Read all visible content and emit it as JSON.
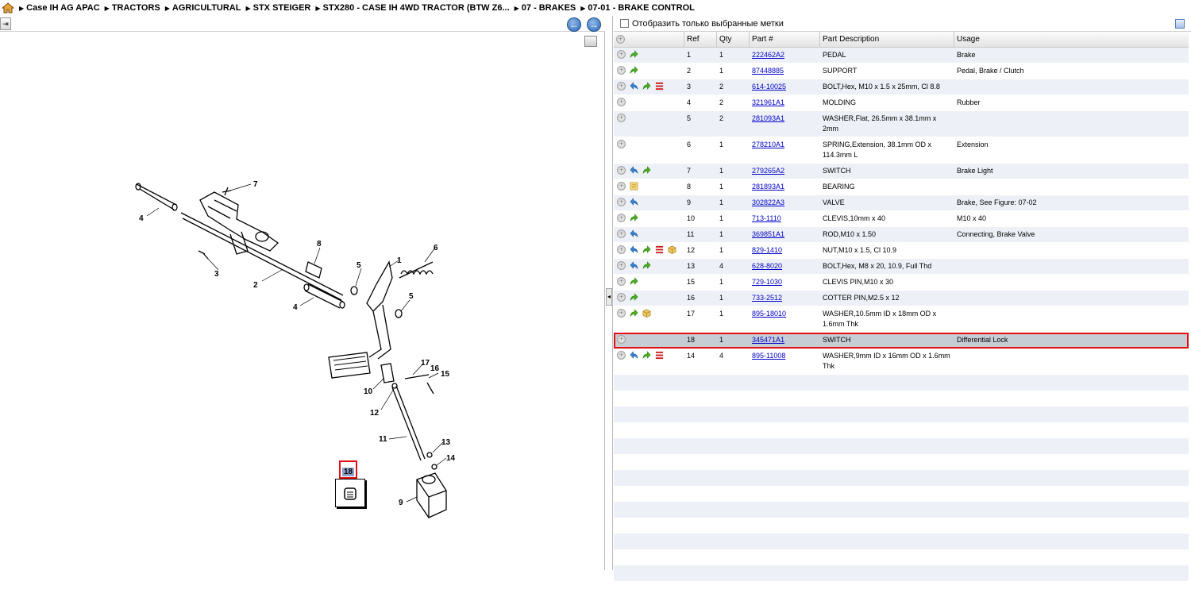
{
  "breadcrumb": [
    "Case IH AG APAC",
    "TRACTORS",
    "AGRICULTURAL",
    "STX STEIGER",
    "STX280 - CASE IH 4WD TRACTOR (BTW Z6...",
    "07 - BRAKES",
    "07-01 - BRAKE CONTROL"
  ],
  "filter": {
    "label": "Отобразить только выбранные метки"
  },
  "columns": {
    "ref": "Ref",
    "qty": "Qty",
    "part": "Part #",
    "desc": "Part Description",
    "usage": "Usage"
  },
  "parts": [
    {
      "icons": [
        "plus",
        "green"
      ],
      "ref": "1",
      "qty": "1",
      "part": "222462A2",
      "desc": "PEDAL",
      "usage": "Brake"
    },
    {
      "icons": [
        "plus",
        "green"
      ],
      "ref": "2",
      "qty": "1",
      "part": "87448885",
      "desc": "SUPPORT",
      "usage": "Pedal, Brake / Clutch"
    },
    {
      "icons": [
        "plus",
        "blue",
        "green",
        "red"
      ],
      "ref": "3",
      "qty": "2",
      "part": "614-10025",
      "desc": "BOLT,Hex, M10 x 1.5 x 25mm, Cl 8.8",
      "usage": ""
    },
    {
      "icons": [
        "plus"
      ],
      "ref": "4",
      "qty": "2",
      "part": "321961A1",
      "desc": "MOLDING",
      "usage": "Rubber"
    },
    {
      "icons": [
        "plus"
      ],
      "ref": "5",
      "qty": "2",
      "part": "281093A1",
      "desc": "WASHER,Flat, 26.5mm x 38.1mm x 2mm",
      "usage": ""
    },
    {
      "icons": [
        "plus"
      ],
      "ref": "6",
      "qty": "1",
      "part": "278210A1",
      "desc": "SPRING,Extension, 38.1mm OD x 114.3mm L",
      "usage": "Extension"
    },
    {
      "icons": [
        "plus",
        "blue",
        "green"
      ],
      "ref": "7",
      "qty": "1",
      "part": "279265A2",
      "desc": "SWITCH",
      "usage": "Brake Light"
    },
    {
      "icons": [
        "plus",
        "note"
      ],
      "ref": "8",
      "qty": "1",
      "part": "281893A1",
      "desc": "BEARING",
      "usage": ""
    },
    {
      "icons": [
        "plus",
        "blue"
      ],
      "ref": "9",
      "qty": "1",
      "part": "302822A3",
      "desc": "VALVE",
      "usage": "Brake, See Figure: 07-02"
    },
    {
      "icons": [
        "plus",
        "green"
      ],
      "ref": "10",
      "qty": "1",
      "part": "713-1110",
      "desc": "CLEVIS,10mm x 40",
      "usage": "M10 x 40"
    },
    {
      "icons": [
        "plus",
        "blue"
      ],
      "ref": "11",
      "qty": "1",
      "part": "369851A1",
      "desc": "ROD,M10 x 1.50",
      "usage": "Connecting, Brake Valve"
    },
    {
      "icons": [
        "plus",
        "blue",
        "green",
        "red",
        "box"
      ],
      "ref": "12",
      "qty": "1",
      "part": "829-1410",
      "desc": "NUT,M10 x 1.5, Cl 10.9",
      "usage": ""
    },
    {
      "icons": [
        "plus",
        "blue",
        "green"
      ],
      "ref": "13",
      "qty": "4",
      "part": "628-8020",
      "desc": "BOLT,Hex, M8 x 20, 10.9, Full Thd",
      "usage": ""
    },
    {
      "icons": [
        "plus",
        "green"
      ],
      "ref": "15",
      "qty": "1",
      "part": "729-1030",
      "desc": "CLEVIS PIN,M10 x 30",
      "usage": ""
    },
    {
      "icons": [
        "plus",
        "green"
      ],
      "ref": "16",
      "qty": "1",
      "part": "733-2512",
      "desc": "COTTER PIN,M2.5 x 12",
      "usage": ""
    },
    {
      "icons": [
        "plus",
        "green",
        "box"
      ],
      "ref": "17",
      "qty": "1",
      "part": "895-18010",
      "desc": "WASHER,10.5mm ID x 18mm OD x 1.6mm Thk",
      "usage": ""
    },
    {
      "icons": [
        "plus"
      ],
      "ref": "18",
      "qty": "1",
      "part": "345471A1",
      "desc": "SWITCH",
      "usage": "Differential Lock",
      "selected": true
    },
    {
      "icons": [
        "plus",
        "blue",
        "green",
        "red"
      ],
      "ref": "14",
      "qty": "4",
      "part": "895-11008",
      "desc": "WASHER,9mm ID x 16mm OD x 1.6mm Thk",
      "usage": ""
    }
  ],
  "diagram": {
    "callouts": [
      "1",
      "2",
      "3",
      "4",
      "4",
      "5",
      "5",
      "6",
      "7",
      "8",
      "9",
      "10",
      "11",
      "12",
      "13",
      "14",
      "15",
      "16",
      "17"
    ],
    "selected_callout": "18"
  }
}
